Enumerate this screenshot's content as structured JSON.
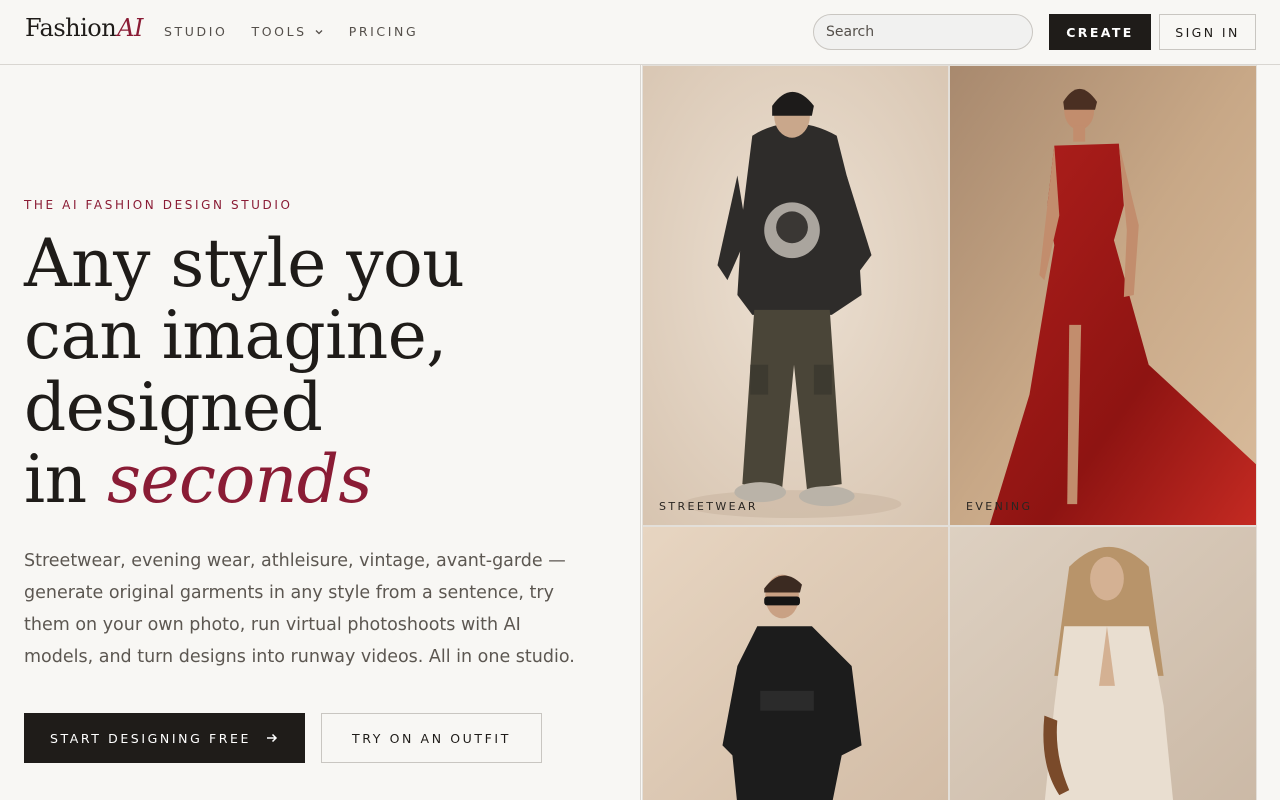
{
  "header": {
    "logo_main": "Fashion",
    "logo_accent": "AI",
    "nav": [
      {
        "label": "STUDIO"
      },
      {
        "label": "TOOLS"
      },
      {
        "label": "PRICING"
      }
    ],
    "search_placeholder": "Search",
    "create_label": "CREATE",
    "signin_label": "SIGN IN"
  },
  "hero": {
    "eyebrow": "THE AI FASHION DESIGN STUDIO",
    "headline_line1": "Any style you",
    "headline_line2": "can imagine,",
    "headline_line3": "designed",
    "headline_line4_prefix": "in",
    "headline_accent": "seconds",
    "description": "Streetwear, evening wear, athleisure, vintage, avant-garde — generate original garments in any style from a sentence, try them on your own photo, run virtual photoshoots with AI models, and turn designs into runway videos. All in one studio.",
    "primary_cta": "START DESIGNING FREE",
    "secondary_cta": "TRY ON AN OUTFIT"
  },
  "gallery": {
    "tiles": [
      {
        "label": "STREETWEAR"
      },
      {
        "label": "EVENING"
      },
      {
        "label": ""
      },
      {
        "label": ""
      }
    ]
  },
  "colors": {
    "accent": "#8a1c35",
    "dark": "#1f1c19",
    "background": "#f8f7f4"
  }
}
